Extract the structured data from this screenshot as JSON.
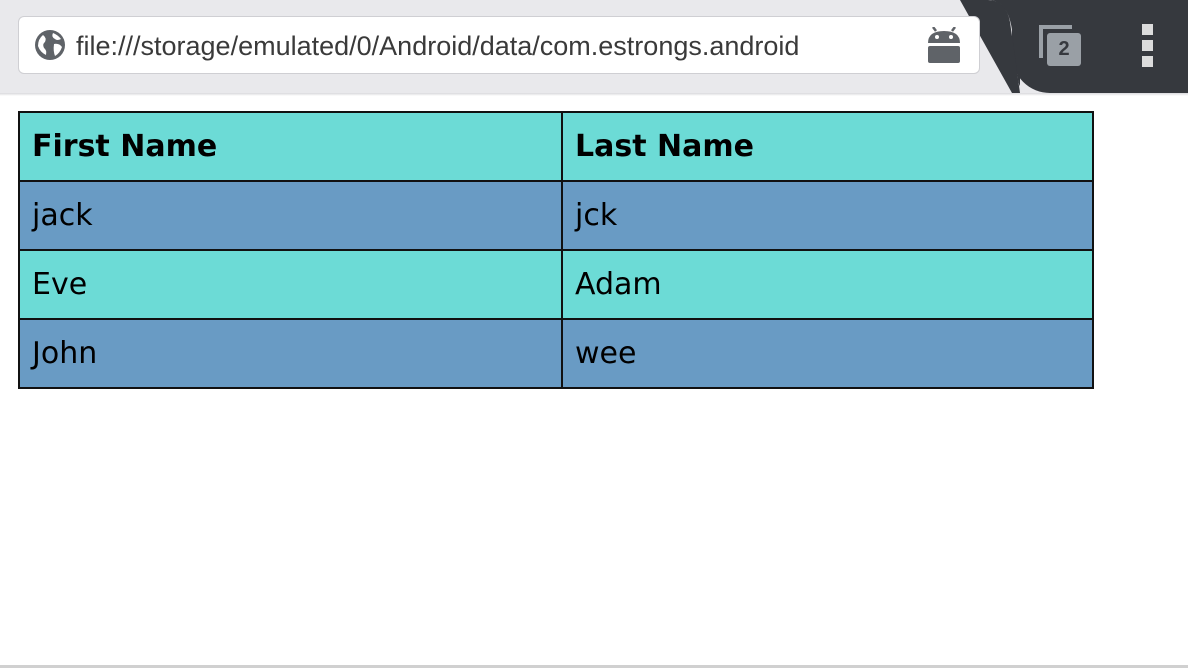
{
  "browser": {
    "url": "file:///storage/emulated/0/Android/data/com.estrongs.android",
    "tab_count": "2",
    "icons": {
      "site_info": "globe-icon",
      "android": "android-icon",
      "tabs": "tab-switcher-icon",
      "menu": "overflow-menu-icon"
    }
  },
  "table": {
    "headers": [
      "First Name",
      "Last Name"
    ],
    "rows": [
      [
        "jack",
        "jck"
      ],
      [
        "Eve",
        "Adam"
      ],
      [
        "John",
        "wee"
      ]
    ]
  },
  "colors": {
    "header_bg": "#6cdbd6",
    "odd_row_bg": "#699bc4",
    "even_row_bg": "#6cdbd6",
    "toolbar_bg": "#e9e9ec",
    "toolbar_dark": "#36393e"
  }
}
